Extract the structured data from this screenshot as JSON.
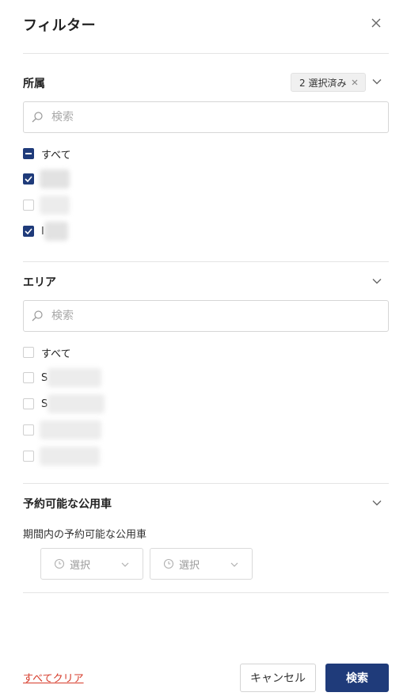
{
  "header": {
    "title": "フィルター",
    "close_icon": "close-icon"
  },
  "affiliation": {
    "title": "所属",
    "badge_label": "2 選択済み",
    "search_placeholder": "検索",
    "all_label": "すべて",
    "all_state": "indeterminate",
    "items": [
      {
        "checked": true,
        "label": ""
      },
      {
        "checked": false,
        "label": ""
      },
      {
        "checked": true,
        "label": "I"
      }
    ]
  },
  "area": {
    "title": "エリア",
    "search_placeholder": "検索",
    "all_label": "すべて",
    "items": [
      {
        "checked": false,
        "label": "S"
      },
      {
        "checked": false,
        "label": "S"
      },
      {
        "checked": false,
        "label": ""
      },
      {
        "checked": false,
        "label": ""
      }
    ]
  },
  "vehicle": {
    "title": "予約可能な公用車",
    "sub_label": "期間内の予約可能な公用車",
    "start_placeholder": "選択",
    "end_placeholder": "選択"
  },
  "footer": {
    "clear_label": "すべてクリア",
    "cancel_label": "キャンセル",
    "search_label": "検索"
  },
  "colors": {
    "accent": "#1f3b7a",
    "danger": "#d63b2a",
    "border": "#d6d6d6"
  }
}
